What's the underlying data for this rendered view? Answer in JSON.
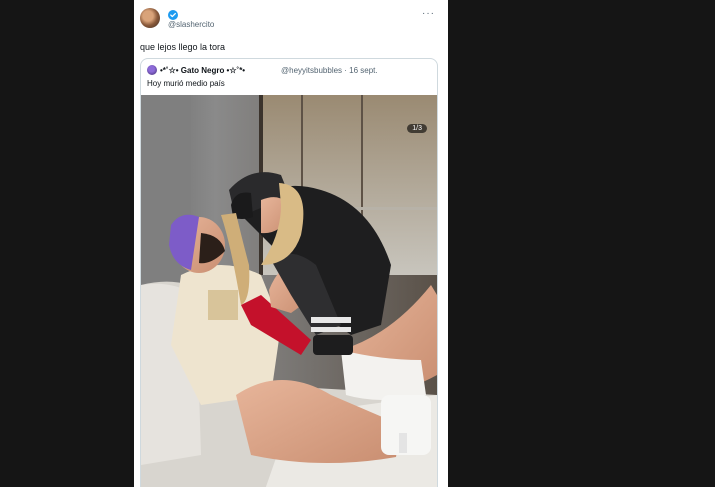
{
  "tweet": {
    "handle": "@slashercito",
    "more_icon": "more-horizontal-icon",
    "text": "que lejos llego la tora"
  },
  "quoted": {
    "name": "•*˚☆• Gato Negro •☆˚*•",
    "handle_date": "@heyyitsbubbles · 16 sept.",
    "text": "Hoy murió medio país"
  },
  "media": {
    "counter": "1/3"
  },
  "colors": {
    "page_bg": "#151515",
    "card_bg": "#ffffff",
    "verified": "#1d9bf0",
    "secondary_text": "#536471"
  }
}
